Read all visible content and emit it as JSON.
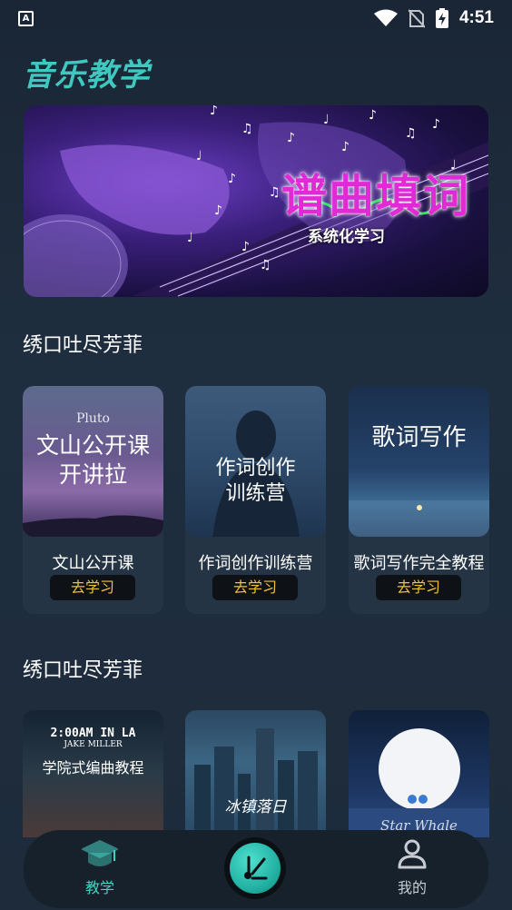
{
  "status_bar": {
    "left_icon": "A",
    "time": "4:51",
    "icons": [
      "wifi-icon",
      "no-sim-icon",
      "battery-charging-icon"
    ]
  },
  "app": {
    "title": "音乐教学"
  },
  "banner": {
    "title": "谱曲填词",
    "subtitle": "系统化学习"
  },
  "sections": [
    {
      "title": "绣口吐尽芳菲",
      "cards": [
        {
          "thumb_lines": [
            "Pluto",
            "文山公开课",
            "开讲拉"
          ],
          "label": "文山公开课",
          "button": "去学习"
        },
        {
          "thumb_lines": [
            "作词创作",
            "训练营"
          ],
          "label": "作词创作训练营",
          "button": "去学习"
        },
        {
          "thumb_lines": [
            "歌词写作"
          ],
          "label": "歌词写作完全教程",
          "button": "去学习"
        }
      ]
    },
    {
      "title": "绣口吐尽芳菲",
      "cards": [
        {
          "thumb_lines": [
            "2:00AM IN LA",
            "JAKE MILLER",
            "学院式编曲教程"
          ]
        },
        {
          "thumb_lines": [
            "冰镇落日"
          ]
        },
        {
          "thumb_lines": [
            "Star Whale"
          ]
        }
      ]
    }
  ],
  "bottom_nav": {
    "items": [
      {
        "label": "教学",
        "icon": "graduation-cap-icon",
        "active": true
      },
      {
        "label": "",
        "icon": "music-note-icon"
      },
      {
        "label": "我的",
        "icon": "user-icon"
      }
    ]
  },
  "colors": {
    "accent_teal": "#3ec9c0",
    "button_text": "#f2c13a",
    "active_nav": "#47d1c3",
    "inactive_nav": "#c8ccd2"
  }
}
